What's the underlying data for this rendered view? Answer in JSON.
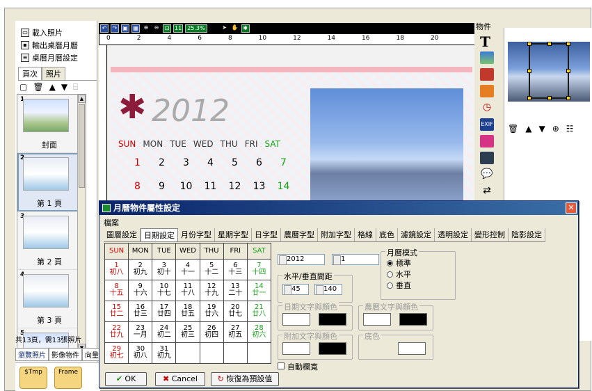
{
  "left_menu": {
    "load_photo": "載入照片",
    "export_calendar": "輸出桌曆月曆",
    "calendar_settings": "桌曆月曆設定"
  },
  "left_tabs": [
    "頁次",
    "照片"
  ],
  "thumbs": [
    {
      "num": "1",
      "caption": "封面"
    },
    {
      "num": "2",
      "caption": "第 1 頁"
    },
    {
      "num": "3",
      "caption": "第 2 頁"
    },
    {
      "num": "4",
      "caption": "第 3 頁"
    },
    {
      "num": "5",
      "caption": ""
    }
  ],
  "status": "共13頁，需13張照片",
  "bottom_tabs": [
    "瀏覽照片",
    "影像物件",
    "向量"
  ],
  "folders": [
    "$Tmp",
    "Frame"
  ],
  "toolbar": {
    "zoom": "25.3%"
  },
  "ruler_marks": [
    "0",
    "2",
    "4",
    "6",
    "8",
    "10",
    "12",
    "14",
    "16",
    "18",
    "20"
  ],
  "canvas": {
    "year": "2012",
    "days": [
      "SUN",
      "MON",
      "TUE",
      "WED",
      "THU",
      "FRI",
      "SAT"
    ],
    "week1": [
      "1",
      "2",
      "3",
      "4",
      "5",
      "6",
      "7"
    ],
    "week2": [
      "8",
      "9",
      "10",
      "11",
      "12",
      "13",
      "14"
    ]
  },
  "right": {
    "objects": "物件",
    "text_tool": "T"
  },
  "dialog": {
    "title": "月曆物件屬性設定",
    "menu": "檔案",
    "tabs": [
      "圖層設定",
      "日期設定",
      "月份字型",
      "星期字型",
      "日字型",
      "農曆字型",
      "附加字型",
      "格線",
      "底色",
      "濾鏡設定",
      "透明設定",
      "變形控制",
      "陰影設定"
    ],
    "week_header": [
      "SUN",
      "MON",
      "TUE",
      "WED",
      "THU",
      "FRI",
      "SAT"
    ],
    "rows": [
      [
        [
          "1",
          "初八"
        ],
        [
          "2",
          "初九"
        ],
        [
          "3",
          "初十"
        ],
        [
          "4",
          "十一"
        ],
        [
          "5",
          "十二"
        ],
        [
          "6",
          "十三"
        ],
        [
          "7",
          "十四"
        ]
      ],
      [
        [
          "8",
          "十五"
        ],
        [
          "9",
          "十六"
        ],
        [
          "10",
          "十七"
        ],
        [
          "11",
          "十八"
        ],
        [
          "12",
          "十九"
        ],
        [
          "13",
          "二十"
        ],
        [
          "14",
          "廿一"
        ]
      ],
      [
        [
          "15",
          "廿二"
        ],
        [
          "16",
          "廿三"
        ],
        [
          "17",
          "廿四"
        ],
        [
          "18",
          "廿五"
        ],
        [
          "19",
          "廿六"
        ],
        [
          "20",
          "廿七"
        ],
        [
          "21",
          "廿八"
        ]
      ],
      [
        [
          "22",
          "廿九"
        ],
        [
          "23",
          "一月"
        ],
        [
          "24",
          "初二"
        ],
        [
          "25",
          "初三"
        ],
        [
          "26",
          "初四"
        ],
        [
          "27",
          "初五"
        ],
        [
          "28",
          "初六"
        ]
      ],
      [
        [
          "29",
          "初七"
        ],
        [
          "30",
          "初八"
        ],
        [
          "31",
          "初九"
        ],
        [
          "",
          ""
        ],
        [
          "",
          ""
        ],
        [
          "",
          ""
        ],
        [
          "",
          ""
        ]
      ]
    ],
    "year_value": "2012",
    "month_value": "1",
    "spacing_label": "水平/垂直間距",
    "h_spacing": "45",
    "v_spacing": "140",
    "mode_label": "月曆模式",
    "modes": [
      "標準",
      "水平",
      "垂直"
    ],
    "date_color_label": "日期文字與顏色",
    "lunar_color_label": "農曆文字與顏色",
    "extra_color_label": "附加文字與顏色",
    "bg_label": "底色",
    "auto_width": "自動欄寬",
    "ok": "OK",
    "cancel": "Cancel",
    "reset": "恢復為預設值"
  },
  "colors": {
    "dialog_title": "#0a246a",
    "red": "#d40000",
    "green": "#19a219"
  }
}
